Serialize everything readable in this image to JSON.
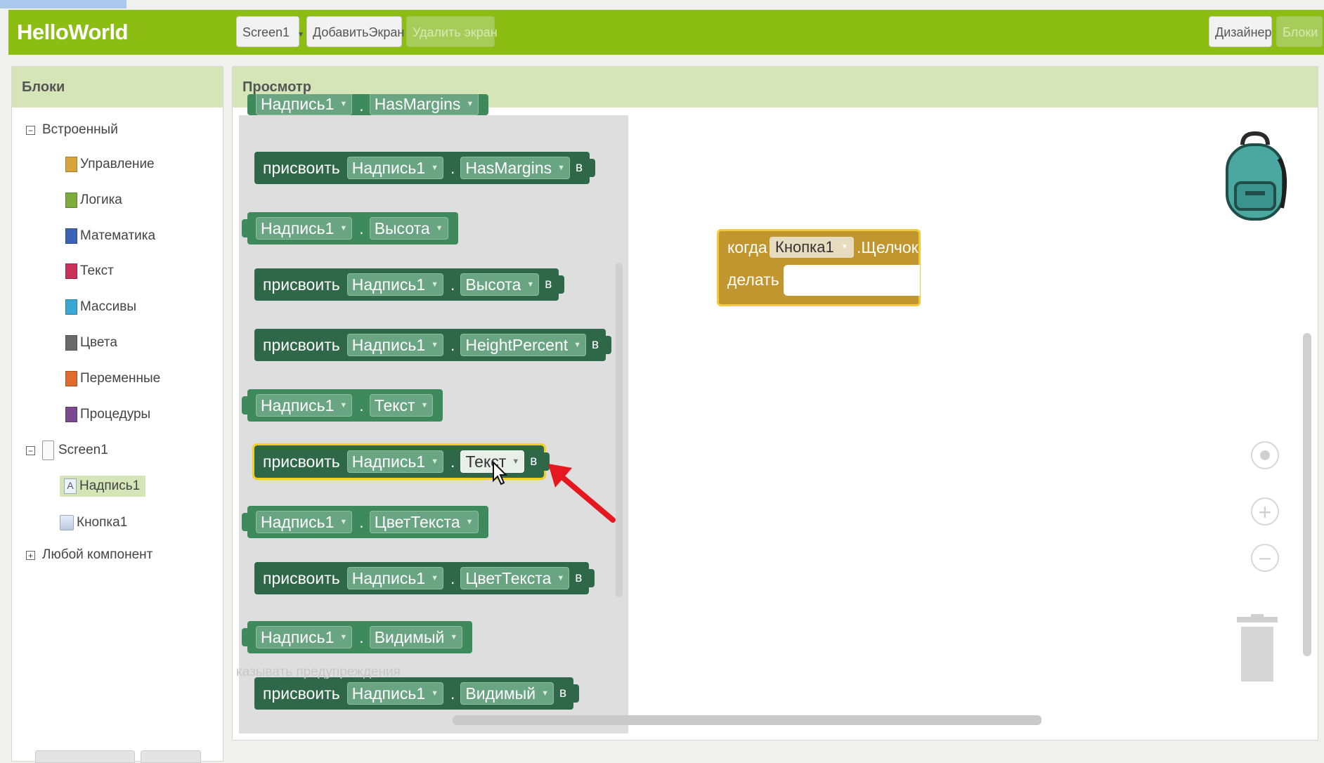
{
  "topbar": {
    "app_title": "HelloWorld",
    "screen_select": "Screen1",
    "add_screen": "ДобавитьЭкран",
    "remove_screen": "Удалить экран",
    "designer": "Дизайнер",
    "blocks": "Блоки",
    "color": "#8bbd13"
  },
  "blocks_panel": {
    "title": "Блоки",
    "builtin_label": "Встроенный",
    "builtin_items": [
      {
        "label": "Управление",
        "color": "#d9a43c"
      },
      {
        "label": "Логика",
        "color": "#7cad3c"
      },
      {
        "label": "Математика",
        "color": "#3c63b8"
      },
      {
        "label": "Текст",
        "color": "#c8325a"
      },
      {
        "label": "Массивы",
        "color": "#39a8d6"
      },
      {
        "label": "Цвета",
        "color": "#6a6a6a"
      },
      {
        "label": "Переменные",
        "color": "#e06b2c"
      },
      {
        "label": "Процедуры",
        "color": "#7b4a93"
      }
    ],
    "screen_label": "Screen1",
    "components": [
      {
        "label": "Надпись1",
        "selected": true
      },
      {
        "label": "Кнопка1",
        "selected": false
      }
    ],
    "any_component": "Любой компонент"
  },
  "viewer": {
    "title": "Просмотр",
    "flyout_blocks": [
      {
        "kind": "getter",
        "component": "Надпись1",
        "property": "HasMargins"
      },
      {
        "kind": "setter",
        "keyword": "присвоить",
        "component": "Надпись1",
        "property": "HasMargins",
        "to": "в"
      },
      {
        "kind": "getter",
        "component": "Надпись1",
        "property": "Высота"
      },
      {
        "kind": "setter",
        "keyword": "присвоить",
        "component": "Надпись1",
        "property": "Высота",
        "to": "в"
      },
      {
        "kind": "setter",
        "keyword": "присвоить",
        "component": "Надпись1",
        "property": "HeightPercent",
        "to": "в"
      },
      {
        "kind": "getter",
        "component": "Надпись1",
        "property": "Текст"
      },
      {
        "kind": "setter",
        "keyword": "присвоить",
        "component": "Надпись1",
        "property": "Текст",
        "to": "в",
        "highlighted": true
      },
      {
        "kind": "getter",
        "component": "Надпись1",
        "property": "ЦветТекста"
      },
      {
        "kind": "setter",
        "keyword": "присвоить",
        "component": "Надпись1",
        "property": "ЦветТекста",
        "to": "в"
      },
      {
        "kind": "getter",
        "component": "Надпись1",
        "property": "Видимый"
      },
      {
        "kind": "setter",
        "keyword": "присвоить",
        "component": "Надпись1",
        "property": "Видимый",
        "to": "в"
      }
    ],
    "event_block": {
      "when": "когда",
      "component": "Кнопка1",
      "event": ".Щелчок",
      "do": "делать"
    },
    "warning_text": "казывать предупреждения"
  }
}
